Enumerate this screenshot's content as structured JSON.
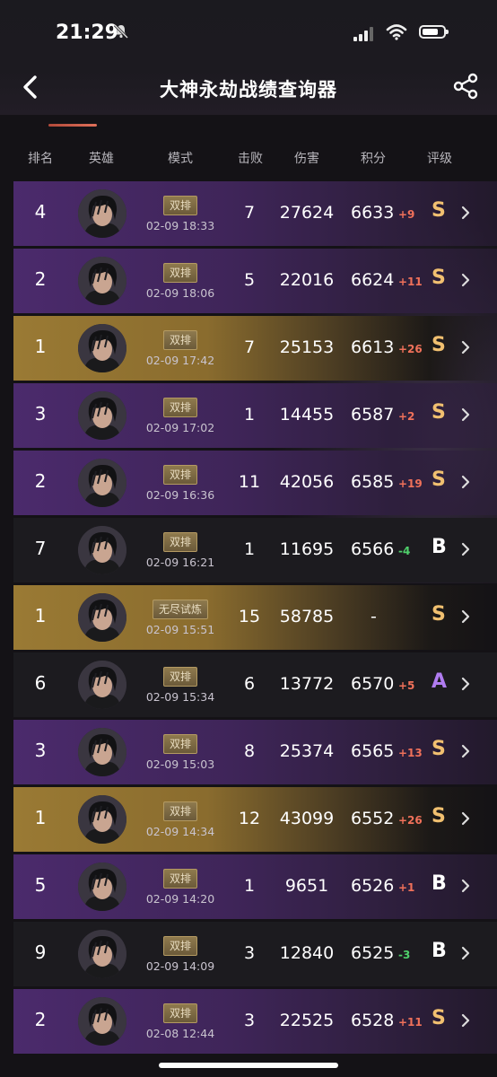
{
  "status_bar": {
    "time": "21:29"
  },
  "nav": {
    "title": "大神永劫战绩查询器"
  },
  "columns": {
    "rank": "排名",
    "hero": "英雄",
    "mode": "模式",
    "kills": "击败",
    "damage": "伤害",
    "score": "积分",
    "grade": "评级"
  },
  "matches": [
    {
      "style": "purple",
      "rank": "4",
      "mode": "双排",
      "time": "02-09 18:33",
      "kills": "7",
      "damage": "27624",
      "score": "6633",
      "delta": "+9",
      "delta_sign": "pos",
      "grade": "S"
    },
    {
      "style": "purple",
      "rank": "2",
      "mode": "双排",
      "time": "02-09 18:06",
      "kills": "5",
      "damage": "22016",
      "score": "6624",
      "delta": "+11",
      "delta_sign": "pos",
      "grade": "S"
    },
    {
      "style": "gold",
      "rank": "1",
      "mode": "双排",
      "time": "02-09 17:42",
      "kills": "7",
      "damage": "25153",
      "score": "6613",
      "delta": "+26",
      "delta_sign": "pos",
      "grade": "S"
    },
    {
      "style": "purple",
      "rank": "3",
      "mode": "双排",
      "time": "02-09 17:02",
      "kills": "1",
      "damage": "14455",
      "score": "6587",
      "delta": "+2",
      "delta_sign": "pos",
      "grade": "S"
    },
    {
      "style": "purple",
      "rank": "2",
      "mode": "双排",
      "time": "02-09 16:36",
      "kills": "11",
      "damage": "42056",
      "score": "6585",
      "delta": "+19",
      "delta_sign": "pos",
      "grade": "S"
    },
    {
      "style": "dark",
      "rank": "7",
      "mode": "双排",
      "time": "02-09 16:21",
      "kills": "1",
      "damage": "11695",
      "score": "6566",
      "delta": "-4",
      "delta_sign": "neg",
      "grade": "B"
    },
    {
      "style": "gold",
      "rank": "1",
      "mode": "无尽试炼",
      "time": "02-09 15:51",
      "kills": "15",
      "damage": "58785",
      "score": "-",
      "delta": "",
      "delta_sign": "",
      "grade": "S"
    },
    {
      "style": "dark",
      "rank": "6",
      "mode": "双排",
      "time": "02-09 15:34",
      "kills": "6",
      "damage": "13772",
      "score": "6570",
      "delta": "+5",
      "delta_sign": "pos",
      "grade": "A"
    },
    {
      "style": "purple",
      "rank": "3",
      "mode": "双排",
      "time": "02-09 15:03",
      "kills": "8",
      "damage": "25374",
      "score": "6565",
      "delta": "+13",
      "delta_sign": "pos",
      "grade": "S"
    },
    {
      "style": "gold",
      "rank": "1",
      "mode": "双排",
      "time": "02-09 14:34",
      "kills": "12",
      "damage": "43099",
      "score": "6552",
      "delta": "+26",
      "delta_sign": "pos",
      "grade": "S"
    },
    {
      "style": "purple",
      "rank": "5",
      "mode": "双排",
      "time": "02-09 14:20",
      "kills": "1",
      "damage": "9651",
      "score": "6526",
      "delta": "+1",
      "delta_sign": "pos",
      "grade": "B"
    },
    {
      "style": "dark",
      "rank": "9",
      "mode": "双排",
      "time": "02-09 14:09",
      "kills": "3",
      "damage": "12840",
      "score": "6525",
      "delta": "-3",
      "delta_sign": "neg",
      "grade": "B"
    },
    {
      "style": "purple",
      "rank": "2",
      "mode": "双排",
      "time": "02-08 12:44",
      "kills": "3",
      "damage": "22525",
      "score": "6528",
      "delta": "+11",
      "delta_sign": "pos",
      "grade": "S"
    }
  ]
}
